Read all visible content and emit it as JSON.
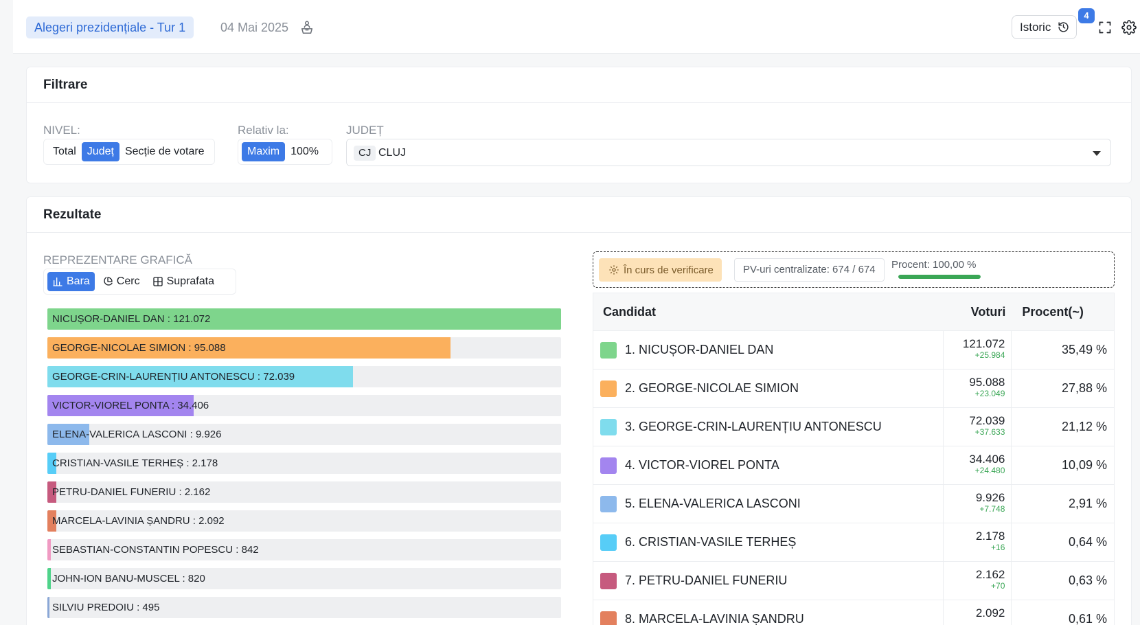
{
  "header": {
    "title": "Alegeri prezidențiale - Tur 1",
    "date": "04 Mai 2025",
    "history_label": "Istoric",
    "history_badge": "4"
  },
  "filter": {
    "heading": "Filtrare",
    "level_label": "NIVEL:",
    "level_options": [
      "Total",
      "Județ",
      "Secție de votare"
    ],
    "level_selected": "Județ",
    "relative_label": "Relativ la:",
    "relative_options": [
      "Maxim",
      "100%"
    ],
    "relative_selected": "Maxim",
    "county_label": "JUDEȚ",
    "county_code": "CJ",
    "county_name": "CLUJ"
  },
  "results": {
    "heading": "Rezultate",
    "graph_label": "REPREZENTARE GRAFICĂ",
    "chart_tabs": [
      "Bara",
      "Cerc",
      "Suprafata"
    ],
    "chart_tab_selected": "Bara",
    "status_label": "În curs de verificare",
    "pv_label": "PV-uri centralizate: 674 / 674",
    "procent_label": "Procent: 100,00 %",
    "procent_value": 1.0,
    "table_headers": [
      "Candidat",
      "Voturi",
      "Procent(~)"
    ]
  },
  "chart_data": {
    "type": "bar",
    "orientation": "horizontal",
    "relative_to": "max",
    "xlim": [
      0,
      121072
    ],
    "categories": [
      "NICUȘOR-DANIEL DAN",
      "GEORGE-NICOLAE SIMION",
      "GEORGE-CRIN-LAURENȚIU ANTONESCU",
      "VICTOR-VIOREL PONTA",
      "ELENA-VALERICA LASCONI",
      "CRISTIAN-VASILE TERHEȘ",
      "PETRU-DANIEL FUNERIU",
      "MARCELA-LAVINIA ȘANDRU",
      "SEBASTIAN-CONSTANTIN POPESCU",
      "JOHN-ION BANU-MUSCEL",
      "SILVIU PREDOIU"
    ],
    "values": [
      121072,
      95088,
      72039,
      34406,
      9926,
      2178,
      2162,
      2092,
      842,
      820,
      495
    ],
    "labels": [
      "NICUȘOR-DANIEL DAN : 121.072",
      "GEORGE-NICOLAE SIMION : 95.088",
      "GEORGE-CRIN-LAURENȚIU ANTONESCU : 72.039",
      "VICTOR-VIOREL PONTA : 34.406",
      "ELENA-VALERICA LASCONI : 9.926",
      "CRISTIAN-VASILE TERHEȘ : 2.178",
      "PETRU-DANIEL FUNERIU : 2.162",
      "MARCELA-LAVINIA ȘANDRU : 2.092",
      "SEBASTIAN-CONSTANTIN POPESCU : 842",
      "JOHN-ION BANU-MUSCEL : 820",
      "SILVIU PREDOIU : 495"
    ],
    "colors": [
      "#7ed58c",
      "#fbb05d",
      "#7fdced",
      "#a385ef",
      "#8db9ec",
      "#57cdf7",
      "#c65a7e",
      "#e3805e",
      "#f09bc3",
      "#4fd38a",
      "#8aa7d6"
    ]
  },
  "table_rows": [
    {
      "candidate": "1. NICUȘOR-DANIEL DAN",
      "votes": "121.072",
      "delta": "+25.984",
      "percent": "35,49 %",
      "color": "#7ed58c"
    },
    {
      "candidate": "2. GEORGE-NICOLAE SIMION",
      "votes": "95.088",
      "delta": "+23.049",
      "percent": "27,88 %",
      "color": "#fbb05d"
    },
    {
      "candidate": "3. GEORGE-CRIN-LAURENȚIU ANTONESCU",
      "votes": "72.039",
      "delta": "+37.633",
      "percent": "21,12 %",
      "color": "#7fdced"
    },
    {
      "candidate": "4. VICTOR-VIOREL PONTA",
      "votes": "34.406",
      "delta": "+24.480",
      "percent": "10,09 %",
      "color": "#a385ef"
    },
    {
      "candidate": "5. ELENA-VALERICA LASCONI",
      "votes": "9.926",
      "delta": "+7.748",
      "percent": "2,91 %",
      "color": "#8db9ec"
    },
    {
      "candidate": "6. CRISTIAN-VASILE TERHEȘ",
      "votes": "2.178",
      "delta": "+16",
      "percent": "0,64 %",
      "color": "#57cdf7"
    },
    {
      "candidate": "7. PETRU-DANIEL FUNERIU",
      "votes": "2.162",
      "delta": "+70",
      "percent": "0,63 %",
      "color": "#c65a7e"
    },
    {
      "candidate": "8. MARCELA-LAVINIA ȘANDRU",
      "votes": "2.092",
      "delta": "",
      "percent": "0,61 %",
      "color": "#e3805e"
    }
  ]
}
